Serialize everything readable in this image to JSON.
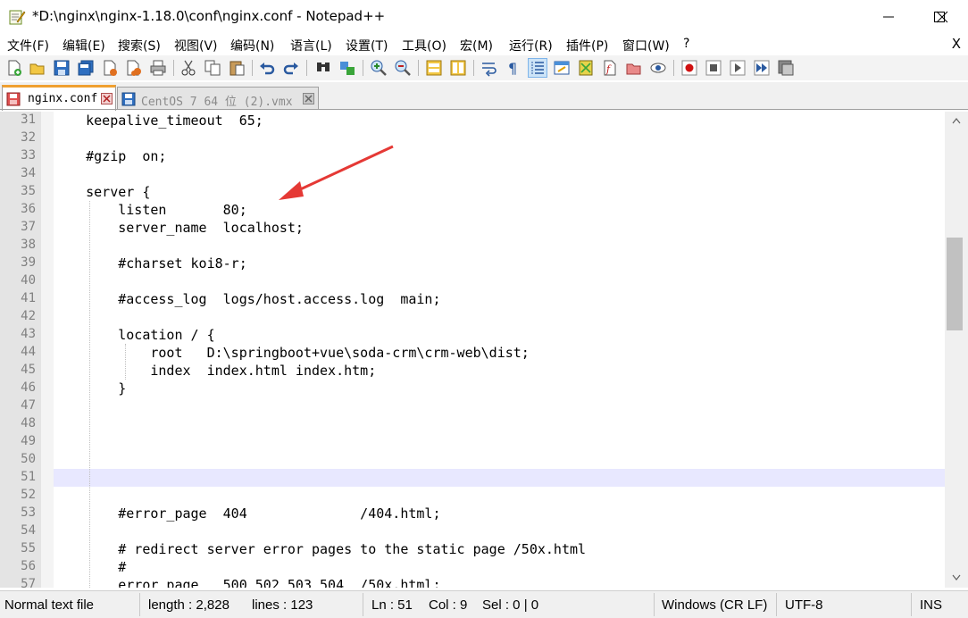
{
  "window": {
    "title": "*D:\\nginx\\nginx-1.18.0\\conf\\nginx.conf - Notepad++"
  },
  "menu": {
    "items": [
      "文件(F)",
      "编辑(E)",
      "搜索(S)",
      "视图(V)",
      "编码(N)",
      "语言(L)",
      "设置(T)",
      "工具(O)",
      "宏(M)",
      "运行(R)",
      "插件(P)",
      "窗口(W)",
      "?"
    ],
    "close": "X"
  },
  "tabs": [
    {
      "label": "nginx.conf",
      "active": true
    },
    {
      "label": "CentOS 7 64 位 (2).vmx",
      "active": false
    }
  ],
  "editor": {
    "current_line": 51,
    "lines": [
      {
        "n": "31",
        "text": "    keepalive_timeout  65;"
      },
      {
        "n": "32",
        "text": ""
      },
      {
        "n": "33",
        "text": "    #gzip  on;"
      },
      {
        "n": "34",
        "text": ""
      },
      {
        "n": "35",
        "text": "    server {"
      },
      {
        "n": "36",
        "text": "        listen       80;"
      },
      {
        "n": "37",
        "text": "        server_name  localhost;"
      },
      {
        "n": "38",
        "text": ""
      },
      {
        "n": "39",
        "text": "        #charset koi8-r;"
      },
      {
        "n": "40",
        "text": ""
      },
      {
        "n": "41",
        "text": "        #access_log  logs/host.access.log  main;"
      },
      {
        "n": "42",
        "text": ""
      },
      {
        "n": "43",
        "text": "        location / {"
      },
      {
        "n": "44",
        "text": "            root   D:\\springboot+vue\\soda-crm\\crm-web\\dist;"
      },
      {
        "n": "45",
        "text": "            index  index.html index.htm;"
      },
      {
        "n": "46",
        "text": "        }"
      },
      {
        "n": "47",
        "text": ""
      },
      {
        "n": "48",
        "text": ""
      },
      {
        "n": "49",
        "text": ""
      },
      {
        "n": "50",
        "text": ""
      },
      {
        "n": "51",
        "text": ""
      },
      {
        "n": "52",
        "text": ""
      },
      {
        "n": "53",
        "text": "        #error_page  404              /404.html;"
      },
      {
        "n": "54",
        "text": ""
      },
      {
        "n": "55",
        "text": "        # redirect server error pages to the static page /50x.html"
      },
      {
        "n": "56",
        "text": "        #"
      },
      {
        "n": "57",
        "text": "        error_page   500 502 503 504  /50x.html;"
      }
    ]
  },
  "status": {
    "file_type": "Normal text file",
    "length": "length : 2,828",
    "lines": "lines : 123",
    "ln": "Ln : 51",
    "col": "Col : 9",
    "sel": "Sel : 0 | 0",
    "eol": "Windows (CR LF)",
    "encoding": "UTF-8",
    "mode": "INS"
  },
  "colors": {
    "current_line": "#e8e8ff",
    "annotation_arrow": "#e53935",
    "active_tab_accent": "#f0a030"
  }
}
